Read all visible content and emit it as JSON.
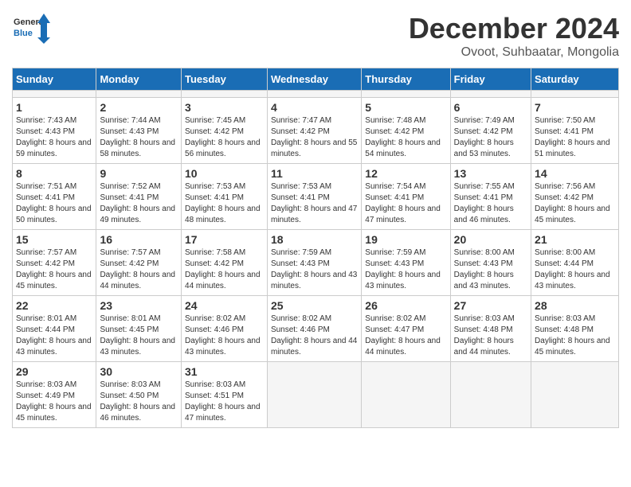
{
  "header": {
    "logo_line1": "General",
    "logo_line2": "Blue",
    "title": "December 2024",
    "subtitle": "Ovoot, Suhbaatar, Mongolia"
  },
  "calendar": {
    "days_of_week": [
      "Sunday",
      "Monday",
      "Tuesday",
      "Wednesday",
      "Thursday",
      "Friday",
      "Saturday"
    ],
    "weeks": [
      [
        {
          "day": "",
          "empty": true
        },
        {
          "day": "",
          "empty": true
        },
        {
          "day": "",
          "empty": true
        },
        {
          "day": "",
          "empty": true
        },
        {
          "day": "",
          "empty": true
        },
        {
          "day": "",
          "empty": true
        },
        {
          "day": "",
          "empty": true
        }
      ],
      [
        {
          "day": "1",
          "sunrise": "7:43 AM",
          "sunset": "4:43 PM",
          "daylight": "8 hours and 59 minutes."
        },
        {
          "day": "2",
          "sunrise": "7:44 AM",
          "sunset": "4:43 PM",
          "daylight": "8 hours and 58 minutes."
        },
        {
          "day": "3",
          "sunrise": "7:45 AM",
          "sunset": "4:42 PM",
          "daylight": "8 hours and 56 minutes."
        },
        {
          "day": "4",
          "sunrise": "7:47 AM",
          "sunset": "4:42 PM",
          "daylight": "8 hours and 55 minutes."
        },
        {
          "day": "5",
          "sunrise": "7:48 AM",
          "sunset": "4:42 PM",
          "daylight": "8 hours and 54 minutes."
        },
        {
          "day": "6",
          "sunrise": "7:49 AM",
          "sunset": "4:42 PM",
          "daylight": "8 hours and 53 minutes."
        },
        {
          "day": "7",
          "sunrise": "7:50 AM",
          "sunset": "4:41 PM",
          "daylight": "8 hours and 51 minutes."
        }
      ],
      [
        {
          "day": "8",
          "sunrise": "7:51 AM",
          "sunset": "4:41 PM",
          "daylight": "8 hours and 50 minutes."
        },
        {
          "day": "9",
          "sunrise": "7:52 AM",
          "sunset": "4:41 PM",
          "daylight": "8 hours and 49 minutes."
        },
        {
          "day": "10",
          "sunrise": "7:53 AM",
          "sunset": "4:41 PM",
          "daylight": "8 hours and 48 minutes."
        },
        {
          "day": "11",
          "sunrise": "7:53 AM",
          "sunset": "4:41 PM",
          "daylight": "8 hours and 47 minutes."
        },
        {
          "day": "12",
          "sunrise": "7:54 AM",
          "sunset": "4:41 PM",
          "daylight": "8 hours and 47 minutes."
        },
        {
          "day": "13",
          "sunrise": "7:55 AM",
          "sunset": "4:41 PM",
          "daylight": "8 hours and 46 minutes."
        },
        {
          "day": "14",
          "sunrise": "7:56 AM",
          "sunset": "4:42 PM",
          "daylight": "8 hours and 45 minutes."
        }
      ],
      [
        {
          "day": "15",
          "sunrise": "7:57 AM",
          "sunset": "4:42 PM",
          "daylight": "8 hours and 45 minutes."
        },
        {
          "day": "16",
          "sunrise": "7:57 AM",
          "sunset": "4:42 PM",
          "daylight": "8 hours and 44 minutes."
        },
        {
          "day": "17",
          "sunrise": "7:58 AM",
          "sunset": "4:42 PM",
          "daylight": "8 hours and 44 minutes."
        },
        {
          "day": "18",
          "sunrise": "7:59 AM",
          "sunset": "4:43 PM",
          "daylight": "8 hours and 43 minutes."
        },
        {
          "day": "19",
          "sunrise": "7:59 AM",
          "sunset": "4:43 PM",
          "daylight": "8 hours and 43 minutes."
        },
        {
          "day": "20",
          "sunrise": "8:00 AM",
          "sunset": "4:43 PM",
          "daylight": "8 hours and 43 minutes."
        },
        {
          "day": "21",
          "sunrise": "8:00 AM",
          "sunset": "4:44 PM",
          "daylight": "8 hours and 43 minutes."
        }
      ],
      [
        {
          "day": "22",
          "sunrise": "8:01 AM",
          "sunset": "4:44 PM",
          "daylight": "8 hours and 43 minutes."
        },
        {
          "day": "23",
          "sunrise": "8:01 AM",
          "sunset": "4:45 PM",
          "daylight": "8 hours and 43 minutes."
        },
        {
          "day": "24",
          "sunrise": "8:02 AM",
          "sunset": "4:46 PM",
          "daylight": "8 hours and 43 minutes."
        },
        {
          "day": "25",
          "sunrise": "8:02 AM",
          "sunset": "4:46 PM",
          "daylight": "8 hours and 44 minutes."
        },
        {
          "day": "26",
          "sunrise": "8:02 AM",
          "sunset": "4:47 PM",
          "daylight": "8 hours and 44 minutes."
        },
        {
          "day": "27",
          "sunrise": "8:03 AM",
          "sunset": "4:48 PM",
          "daylight": "8 hours and 44 minutes."
        },
        {
          "day": "28",
          "sunrise": "8:03 AM",
          "sunset": "4:48 PM",
          "daylight": "8 hours and 45 minutes."
        }
      ],
      [
        {
          "day": "29",
          "sunrise": "8:03 AM",
          "sunset": "4:49 PM",
          "daylight": "8 hours and 45 minutes."
        },
        {
          "day": "30",
          "sunrise": "8:03 AM",
          "sunset": "4:50 PM",
          "daylight": "8 hours and 46 minutes."
        },
        {
          "day": "31",
          "sunrise": "8:03 AM",
          "sunset": "4:51 PM",
          "daylight": "8 hours and 47 minutes."
        },
        {
          "day": "",
          "empty": true
        },
        {
          "day": "",
          "empty": true
        },
        {
          "day": "",
          "empty": true
        },
        {
          "day": "",
          "empty": true
        }
      ]
    ]
  }
}
